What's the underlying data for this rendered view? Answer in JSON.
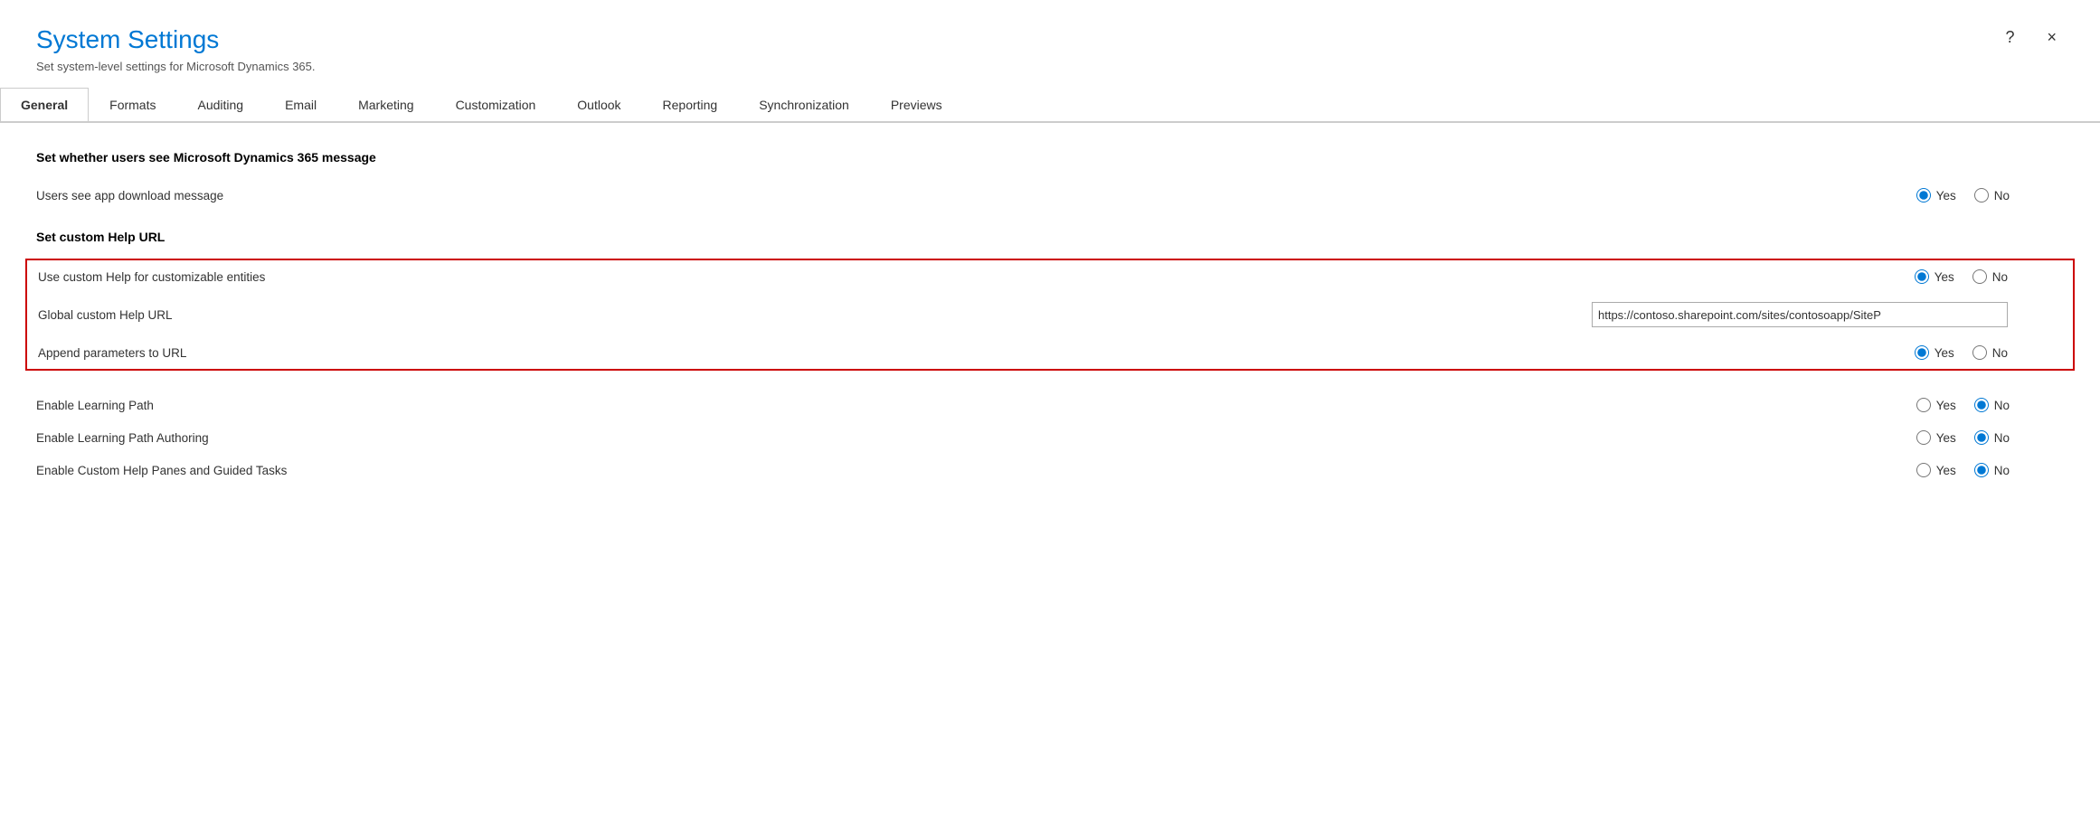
{
  "dialog": {
    "title": "System Settings",
    "subtitle": "Set system-level settings for Microsoft Dynamics 365.",
    "close_label": "×",
    "help_label": "?"
  },
  "tabs": [
    {
      "id": "general",
      "label": "General",
      "active": true
    },
    {
      "id": "formats",
      "label": "Formats",
      "active": false
    },
    {
      "id": "auditing",
      "label": "Auditing",
      "active": false
    },
    {
      "id": "email",
      "label": "Email",
      "active": false
    },
    {
      "id": "marketing",
      "label": "Marketing",
      "active": false
    },
    {
      "id": "customization",
      "label": "Customization",
      "active": false
    },
    {
      "id": "outlook",
      "label": "Outlook",
      "active": false
    },
    {
      "id": "reporting",
      "label": "Reporting",
      "active": false
    },
    {
      "id": "synchronization",
      "label": "Synchronization",
      "active": false
    },
    {
      "id": "previews",
      "label": "Previews",
      "active": false
    }
  ],
  "sections": {
    "dynamics_message": {
      "heading": "Set whether users see Microsoft Dynamics 365 message",
      "rows": [
        {
          "id": "users_see_app_download",
          "label": "Users see app download message",
          "type": "radio",
          "selected": "yes"
        }
      ]
    },
    "custom_help_url": {
      "heading": "Set custom Help URL",
      "highlighted": true,
      "rows": [
        {
          "id": "use_custom_help",
          "label": "Use custom Help for customizable entities",
          "type": "radio",
          "selected": "yes"
        },
        {
          "id": "global_custom_help_url",
          "label": "Global custom Help URL",
          "type": "text",
          "value": "https://contoso.sharepoint.com/sites/contosoapp/SiteP"
        },
        {
          "id": "append_parameters",
          "label": "Append parameters to URL",
          "type": "radio",
          "selected": "yes"
        }
      ]
    },
    "learning": {
      "rows": [
        {
          "id": "enable_learning_path",
          "label": "Enable Learning Path",
          "type": "radio",
          "selected": "no"
        },
        {
          "id": "enable_learning_path_authoring",
          "label": "Enable Learning Path Authoring",
          "type": "radio",
          "selected": "no"
        },
        {
          "id": "enable_custom_help_panes",
          "label": "Enable Custom Help Panes and Guided Tasks",
          "type": "radio",
          "selected": "no"
        }
      ]
    }
  },
  "radio_labels": {
    "yes": "Yes",
    "no": "No"
  }
}
